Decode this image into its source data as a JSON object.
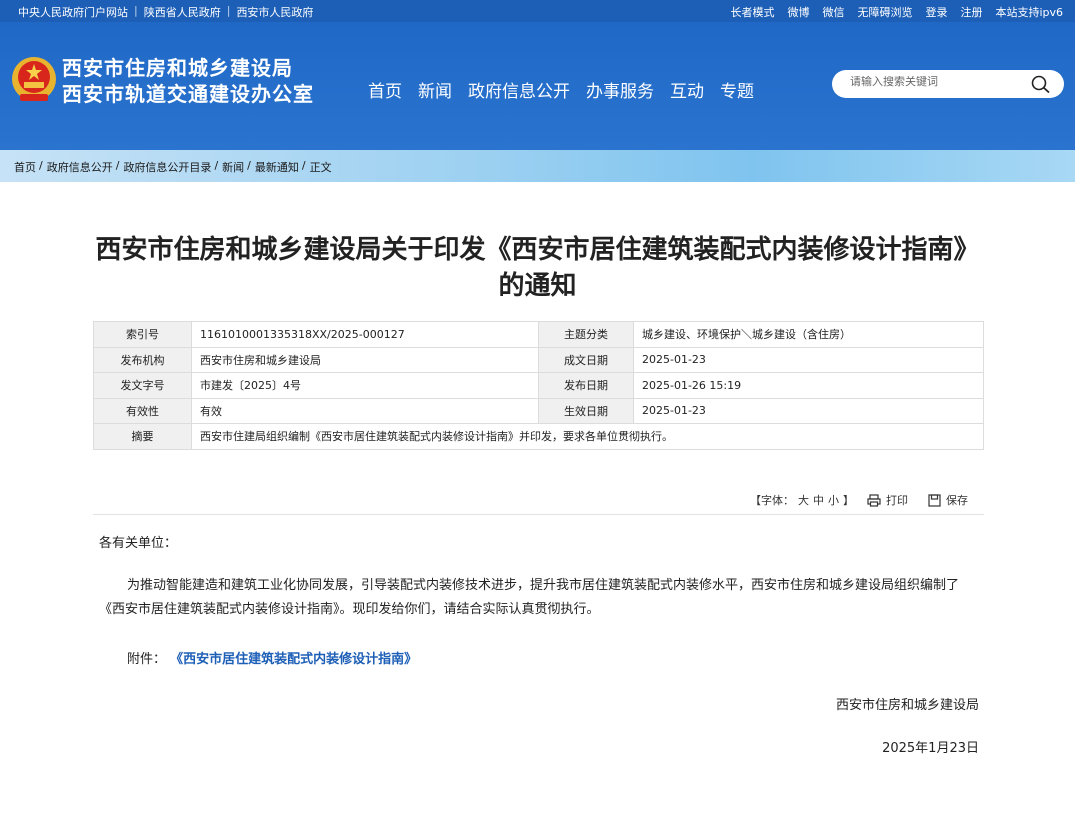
{
  "topbar": {
    "links": [
      "中央人民政府门户网站",
      "陕西省人民政府",
      "西安市人民政府"
    ],
    "right": [
      "长者模式",
      "微博",
      "微信",
      "无障碍浏览",
      "登录",
      "注册",
      "本站支持ipv6"
    ]
  },
  "header": {
    "org_line1": "西安市住房和城乡建设局",
    "org_line2": "西安市轨道交通建设办公室",
    "nav": [
      "首页",
      "新闻",
      "政府信息公开",
      "办事服务",
      "互动",
      "专题"
    ],
    "search_placeholder": "请输入搜索关键词"
  },
  "breadcrumb": [
    "首页",
    "政府信息公开",
    "政府信息公开目录",
    "新闻",
    "最新通知",
    "正文"
  ],
  "article": {
    "title_line1": "西安市住房和城乡建设局关于印发《西安市居住建筑装配式内装修设计指南》",
    "title_line2": "的通知",
    "meta": {
      "index_label": "索引号",
      "index_value": "1161010001335318XX/2025-000127",
      "topic_label": "主题分类",
      "topic_value": "城乡建设、环境保护＼城乡建设（含住房）",
      "issuer_label": "发布机构",
      "issuer_value": "西安市住房和城乡建设局",
      "created_label": "成文日期",
      "created_value": "2025-01-23",
      "docno_label": "发文字号",
      "docno_value": "市建发〔2025〕4号",
      "published_label": "发布日期",
      "published_value": "2025-01-26 15:19",
      "validity_label": "有效性",
      "validity_value": "有效",
      "effective_label": "生效日期",
      "effective_value": "2025-01-23",
      "abstract_label": "摘要",
      "abstract_value": "西安市住建局组织编制《西安市居住建筑装配式内装修设计指南》并印发，要求各单位贯彻执行。"
    },
    "tools": {
      "font_prefix": "【字体：",
      "font_large": "大",
      "font_medium": "中",
      "font_small": "小",
      "font_suffix": "】",
      "print": "打印",
      "save": "保存"
    },
    "greeting": "各有关单位：",
    "paragraph": "为推动智能建造和建筑工业化协同发展，引导装配式内装修技术进步，提升我市居住建筑装配式内装修水平，西安市住房和城乡建设局组织编制了《西安市居住建筑装配式内装修设计指南》。现印发给你们，请结合实际认真贯彻执行。",
    "attachment_label": "附件：",
    "attachment_link": "《西安市居住建筑装配式内装修设计指南》",
    "signature": "西安市住房和城乡建设局",
    "date": "2025年1月23日"
  },
  "colors": {
    "brand": "#2068c6",
    "link": "#1d5fb7"
  }
}
